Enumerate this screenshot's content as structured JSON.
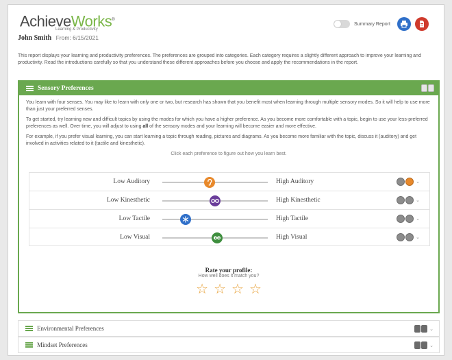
{
  "brand": {
    "part1": "Achieve",
    "part2": "Works",
    "mark": "®",
    "tagline": "Learning & Productivity"
  },
  "user": {
    "name": "John Smith",
    "from_label": "From: 6/15/2021"
  },
  "summary": {
    "label": "Summary Report"
  },
  "intro": "This report displays your learning and productivity preferences. The preferences are grouped into categories. Each category requires a slightly different approach to improve your learning and productivity. Read the introductions carefully so that you understand these different approaches before you choose and apply the recommendations in the report.",
  "sensory": {
    "title": "Sensory Preferences",
    "p1": "You learn with four senses. You may like to learn with only one or two, but research has shown that you benefit most when learning through multiple sensory modes. So it will help to use more than just your preferred senses.",
    "p2_pre": "To get started, try learning new and difficult topics by using the modes for which you have a higher preference. As you become more comfortable with a topic, begin to use your less-preferred preferences as well. Over time, you will adjust to using ",
    "p2_bold": "all",
    "p2_post": " of the sensory modes and your learning will become easier and more effective.",
    "p3": "For example, if you prefer visual learning, you can start learning a topic through reading, pictures and diagrams. As you become more familiar with the topic, discuss it (auditory) and get involved in activities related to it (tactile and kinesthetic).",
    "hint": "Click each preference to figure out how you learn best.",
    "rows": [
      {
        "low": "Low Auditory",
        "high": "High Auditory",
        "value": 0.45,
        "color": "#e8892b",
        "icon": "ear-icon"
      },
      {
        "low": "Low Kinesthetic",
        "high": "High Kinesthetic",
        "value": 0.5,
        "color": "#6a3d9a",
        "icon": "infinity-icon"
      },
      {
        "low": "Low Tactile",
        "high": "High Tactile",
        "value": 0.22,
        "color": "#2f6fc9",
        "icon": "snowflake-icon"
      },
      {
        "low": "Low Visual",
        "high": "High Visual",
        "value": 0.52,
        "color": "#3e8e3e",
        "icon": "eyes-icon"
      }
    ],
    "rate_title": "Rate your profile:",
    "rate_sub": "How well does it match you?",
    "stars": [
      "☆",
      "☆",
      "☆",
      "☆"
    ]
  },
  "panels": [
    {
      "title": "Environmental Preferences"
    },
    {
      "title": "Mindset Preferences"
    }
  ],
  "colors": {
    "accent": "#6aa84f",
    "star": "#e8a33c",
    "print": "#2f6fc9",
    "pdf": "#cf3a2c"
  }
}
